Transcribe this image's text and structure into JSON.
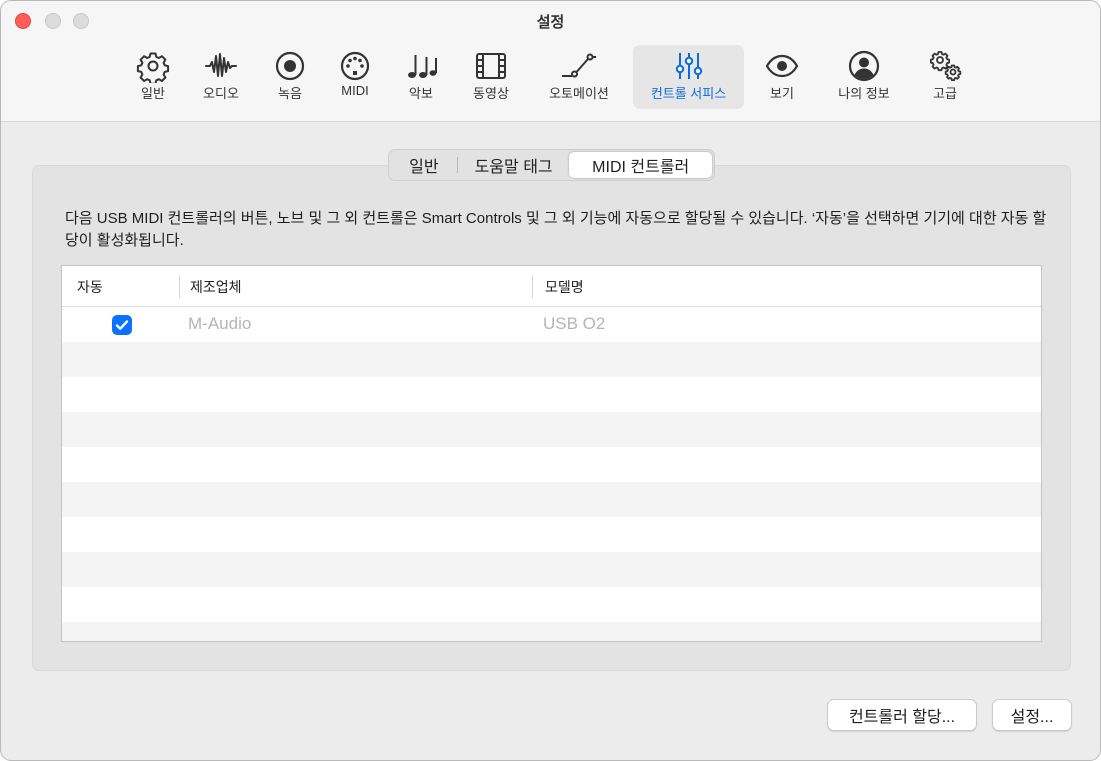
{
  "window": {
    "title": "설정"
  },
  "toolbar": {
    "items": [
      {
        "label": "일반",
        "icon": "gear-icon"
      },
      {
        "label": "오디오",
        "icon": "waveform-icon"
      },
      {
        "label": "녹음",
        "icon": "record-icon"
      },
      {
        "label": "MIDI",
        "icon": "midi-port-icon"
      },
      {
        "label": "악보",
        "icon": "music-notes-icon"
      },
      {
        "label": "동영상",
        "icon": "film-icon"
      },
      {
        "label": "오토메이션",
        "icon": "automation-curve-icon"
      },
      {
        "label": "컨트롤 서피스",
        "icon": "sliders-icon",
        "selected": true
      },
      {
        "label": "보기",
        "icon": "eye-icon"
      },
      {
        "label": "나의 정보",
        "icon": "person-icon"
      },
      {
        "label": "고급",
        "icon": "gears-icon"
      }
    ],
    "accent_color": "#0a6cdd"
  },
  "segments": {
    "general": "일반",
    "help_tags": "도움말 태그",
    "midi_controllers": "MIDI 컨트롤러",
    "selected": "MIDI 컨트롤러"
  },
  "description": "다음 USB MIDI 컨트롤러의 버튼, 노브 및 그 외 컨트롤은 Smart Controls 및 그 외 기능에 자동으로 할당될 수 있습니다. ‘자동’을 선택하면 기기에 대한 자동 할당이 활성화됩니다.",
  "table": {
    "columns": {
      "auto": "자동",
      "manufacturer": "제조업체",
      "model": "모델명"
    },
    "rows": [
      {
        "auto": true,
        "manufacturer": "M-Audio",
        "model": "USB O2"
      }
    ]
  },
  "buttons": {
    "controller_assignments": "컨트롤러 할당...",
    "settings": "설정..."
  }
}
